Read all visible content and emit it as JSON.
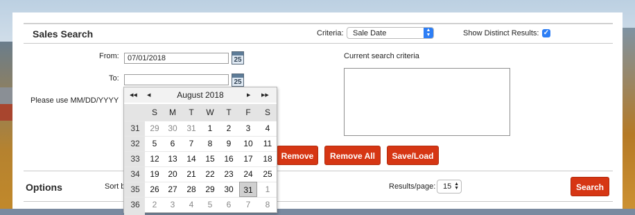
{
  "sales_search": {
    "title": "Sales Search",
    "criteria_label": "Criteria:",
    "criteria_value": "Sale Date",
    "distinct_label": "Show Distinct Results:",
    "distinct_checked": true,
    "from_label": "From:",
    "from_value": "07/01/2018",
    "to_label": "To:",
    "to_value": "",
    "date_hint": "Please use MM/DD/YYYY",
    "current_criteria_label": "Current search criteria",
    "calendar_icon_day": "25",
    "remove_label": "Remove",
    "remove_all_label": "Remove All",
    "save_load_label": "Save/Load"
  },
  "options": {
    "title": "Options",
    "sort_label": "Sort b",
    "results_per_page_label": "Results/page:",
    "results_per_page_value": "15",
    "search_label": "Search"
  },
  "calendar": {
    "month_label": "August 2018",
    "nav": {
      "prev_year": "◀◀",
      "prev_month": "◀",
      "next_month": "▶",
      "next_year": "▶▶"
    },
    "weekdays": [
      "S",
      "M",
      "T",
      "W",
      "T",
      "F",
      "S"
    ],
    "weeks": [
      {
        "week": "31",
        "days": [
          "29",
          "30",
          "31",
          "1",
          "2",
          "3",
          "4"
        ],
        "other": [
          true,
          true,
          true,
          false,
          false,
          false,
          false
        ]
      },
      {
        "week": "32",
        "days": [
          "5",
          "6",
          "7",
          "8",
          "9",
          "10",
          "11"
        ],
        "other": [
          false,
          false,
          false,
          false,
          false,
          false,
          false
        ]
      },
      {
        "week": "33",
        "days": [
          "12",
          "13",
          "14",
          "15",
          "16",
          "17",
          "18"
        ],
        "other": [
          false,
          false,
          false,
          false,
          false,
          false,
          false
        ]
      },
      {
        "week": "34",
        "days": [
          "19",
          "20",
          "21",
          "22",
          "23",
          "24",
          "25"
        ],
        "other": [
          false,
          false,
          false,
          false,
          false,
          false,
          false
        ]
      },
      {
        "week": "35",
        "days": [
          "26",
          "27",
          "28",
          "29",
          "30",
          "31",
          "1"
        ],
        "other": [
          false,
          false,
          false,
          false,
          false,
          false,
          true
        ]
      },
      {
        "week": "36",
        "days": [
          "2",
          "3",
          "4",
          "5",
          "6",
          "7",
          "8"
        ],
        "other": [
          true,
          true,
          true,
          true,
          true,
          true,
          true
        ]
      }
    ],
    "selected_day": "31"
  },
  "colors": {
    "accent_button": "#d63614",
    "select_accent": "#2d7ef5"
  }
}
